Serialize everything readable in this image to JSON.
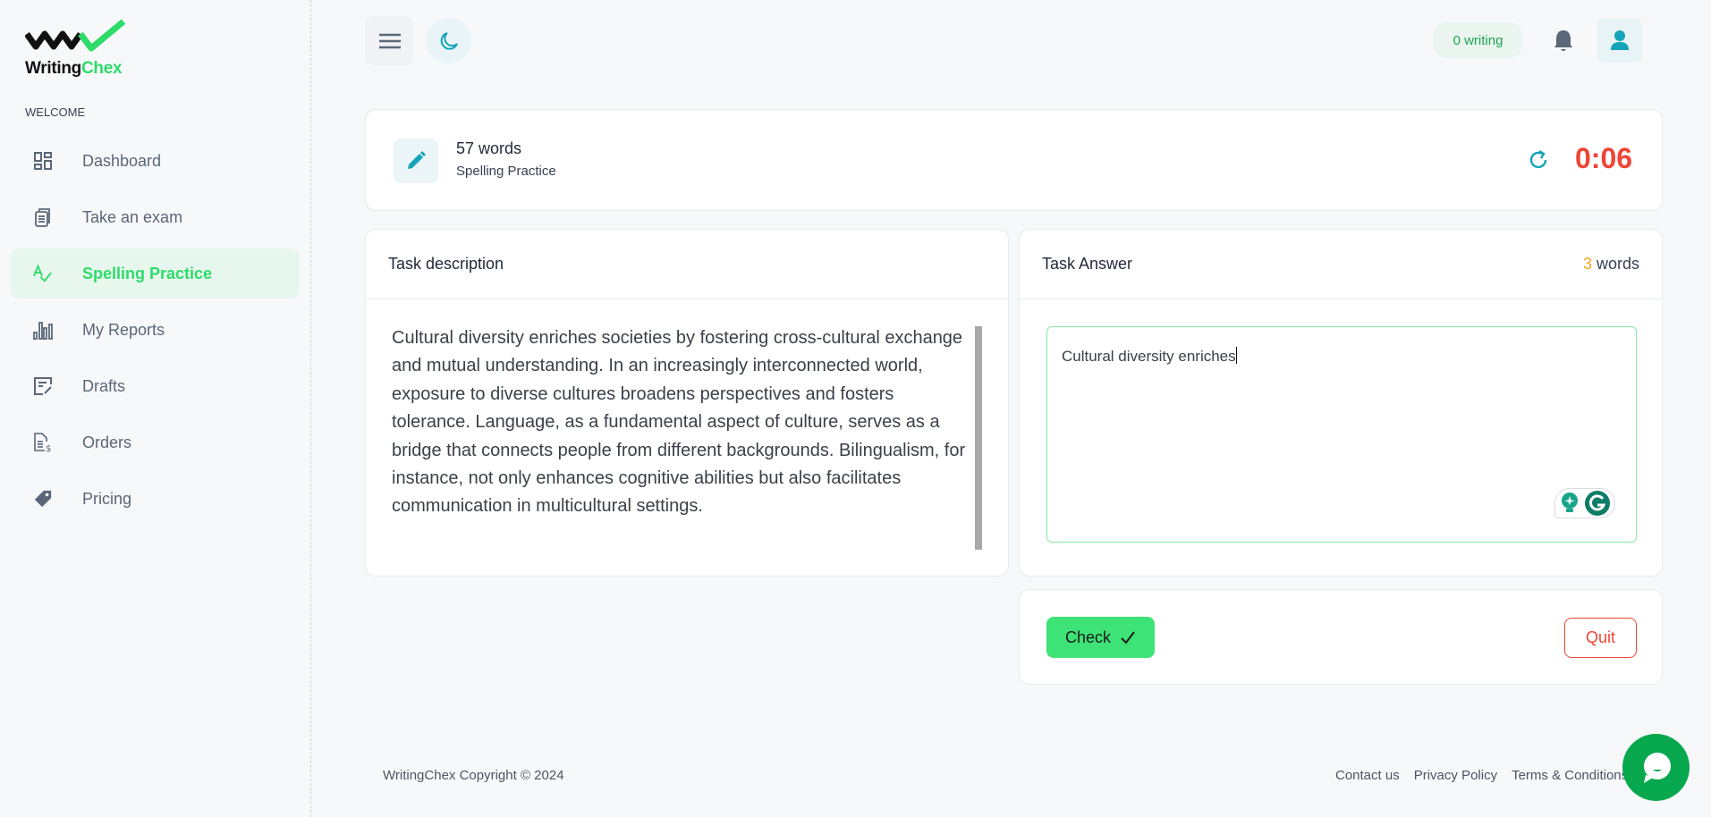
{
  "brand": {
    "name_part1": "Writing",
    "name_part2": "Chex",
    "accent_color": "#2ddc6a"
  },
  "sidebar": {
    "section_label": "WELCOME",
    "items": [
      {
        "label": "Dashboard",
        "icon": "dashboard-icon",
        "active": false
      },
      {
        "label": "Take an exam",
        "icon": "clipboard-icon",
        "active": false
      },
      {
        "label": "Spelling Practice",
        "icon": "spellcheck-icon",
        "active": true
      },
      {
        "label": "My Reports",
        "icon": "bar-chart-icon",
        "active": false
      },
      {
        "label": "Drafts",
        "icon": "edit-document-icon",
        "active": false
      },
      {
        "label": "Orders",
        "icon": "invoice-icon",
        "active": false
      },
      {
        "label": "Pricing",
        "icon": "tag-icon",
        "active": false
      }
    ]
  },
  "topbar": {
    "writing_badge": "0 writing"
  },
  "info": {
    "words": "57 words",
    "mode": "Spelling Practice",
    "timer": "0:06",
    "timer_color": "#ef4435"
  },
  "task_description": {
    "title": "Task description",
    "text": "Cultural diversity enriches societies by fostering cross-cultural exchange and mutual understanding. In an increasingly interconnected world, exposure to diverse cultures broadens perspectives and fosters tolerance. Language, as a fundamental aspect of culture, serves as a bridge that connects people from different backgrounds. Bilingualism, for instance, not only enhances cognitive abilities but also facilitates communication in multicultural settings."
  },
  "task_answer": {
    "title": "Task Answer",
    "word_count": "3",
    "word_label": " words",
    "value": "Cultural diversity enriches"
  },
  "actions": {
    "check_label": "Check",
    "quit_label": "Quit"
  },
  "footer": {
    "copyright": "WritingChex Copyright © 2024",
    "links": [
      "Contact us",
      "Privacy Policy",
      "Terms & Conditions"
    ]
  }
}
